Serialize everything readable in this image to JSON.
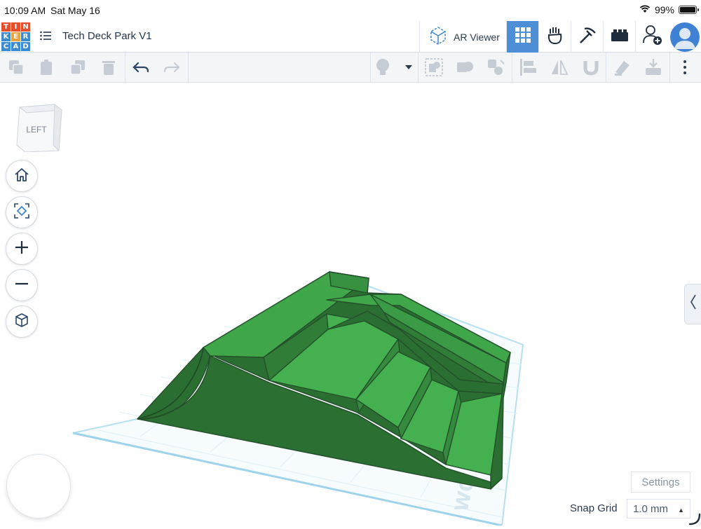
{
  "status_bar": {
    "time": "10:09 AM",
    "date": "Sat May 16",
    "battery": "99%"
  },
  "app": {
    "logo_letters": [
      "T",
      "I",
      "N",
      "K",
      "E",
      "R",
      "C",
      "A",
      "D"
    ],
    "logo_colors": [
      "#e4502e",
      "#e4502e",
      "#e4502e",
      "#3c8bd0",
      "#e9a33b",
      "#3c8bd0",
      "#3c8bd0",
      "#3c8bd0",
      "#3c8bd0"
    ],
    "title": "Tech Deck Park V1",
    "ar_viewer_label": "AR Viewer"
  },
  "header_icons": [
    "grid-view-icon",
    "tinker-hand-icon",
    "pickaxe-icon",
    "bricks-icon",
    "add-user-icon",
    "avatar"
  ],
  "toolbar": {
    "left_tools": [
      "copy-icon",
      "paste-icon",
      "duplicate-icon",
      "delete-icon",
      "undo-icon",
      "redo-icon"
    ],
    "right_tools": [
      "light-bulb-icon",
      "dropdown-caret-icon",
      "group-icon",
      "ungroup-icon",
      "cruise-icon",
      "align-icon",
      "mirror-icon",
      "magnet-icon",
      "notes-icon",
      "export-icon",
      "more-icon"
    ]
  },
  "viewcube": {
    "face_label": "LEFT"
  },
  "nav_buttons": [
    "home-view",
    "fit-view",
    "zoom-in",
    "zoom-out",
    "perspective-toggle"
  ],
  "workplane": {
    "watermark": "WO"
  },
  "scene": {
    "object_color": "#3ea84a",
    "object_dark": "#2a6e31",
    "grid_color": "#cbe9f7"
  },
  "bottom": {
    "settings_label": "Settings",
    "snap_grid_label": "Snap Grid",
    "snap_grid_value": "1.0 mm"
  }
}
